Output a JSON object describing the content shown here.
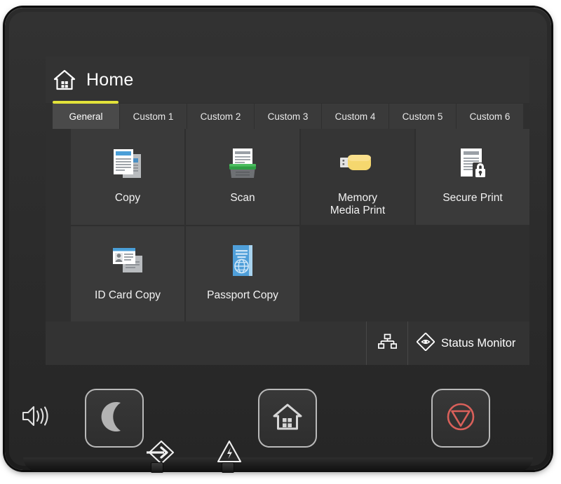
{
  "device": {
    "type": "printer-control-panel"
  },
  "screen": {
    "header": {
      "title": "Home",
      "home_icon": "home-icon",
      "accent_color": "#e3e33a"
    },
    "tabs": [
      {
        "label": "General",
        "active": true
      },
      {
        "label": "Custom 1",
        "active": false
      },
      {
        "label": "Custom 2",
        "active": false
      },
      {
        "label": "Custom 3",
        "active": false
      },
      {
        "label": "Custom 4",
        "active": false
      },
      {
        "label": "Custom 5",
        "active": false
      },
      {
        "label": "Custom 6",
        "active": false
      }
    ],
    "tiles": [
      {
        "label": "Copy",
        "icon": "copy-documents-icon",
        "accent": "#4a9fd8"
      },
      {
        "label": "Scan",
        "icon": "scanner-icon",
        "accent": "#2f9e44"
      },
      {
        "label": "Memory\nMedia Print",
        "label_line1": "Memory",
        "label_line2": "Media Print",
        "icon": "usb-flash-drive-icon",
        "accent": "#f5d76e"
      },
      {
        "label": "Secure Print",
        "icon": "document-lock-icon",
        "accent": "#c9c9c9"
      },
      {
        "label": "ID Card Copy",
        "icon": "id-card-icon",
        "accent": "#4a9fd8"
      },
      {
        "label": "Passport Copy",
        "icon": "passport-book-icon",
        "accent": "#5aa9e0"
      }
    ],
    "status_bar": {
      "network_icon": "network-tree-icon",
      "status_monitor_icon": "eye-diamond-icon",
      "status_monitor_label": "Status Monitor"
    }
  },
  "hardware": {
    "speaker_icon": "speaker-volume-icon",
    "buttons": [
      {
        "name": "sleep",
        "icon": "crescent-moon-icon",
        "color": "#b3b3b3"
      },
      {
        "name": "home",
        "icon": "home-house-icon",
        "color": "#d6d6d6"
      },
      {
        "name": "stop",
        "icon": "stop-circle-triangle-icon",
        "color": "#d9605a"
      }
    ],
    "indicators": [
      {
        "name": "data",
        "icon": "arrow-into-diamond-icon"
      },
      {
        "name": "error",
        "icon": "warning-triangle-bolt-icon"
      }
    ]
  }
}
